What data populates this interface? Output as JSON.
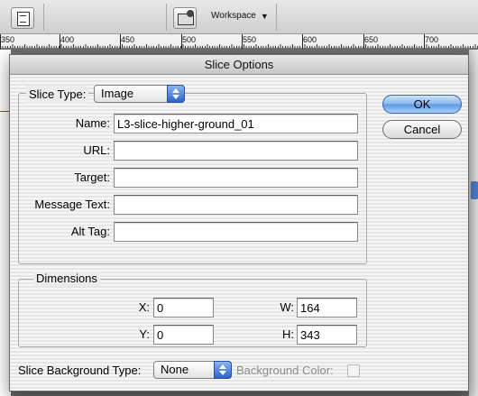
{
  "app": {
    "workspace_label": "Workspace",
    "ruler_labels": [
      "350",
      "400",
      "450",
      "500",
      "550",
      "600",
      "650",
      "700"
    ]
  },
  "dialog": {
    "title": "Slice Options",
    "slice_type": {
      "label": "Slice Type:",
      "value": "Image"
    },
    "fields": {
      "name": {
        "label": "Name:",
        "value": "L3-slice-higher-ground_01"
      },
      "url": {
        "label": "URL:",
        "value": ""
      },
      "target": {
        "label": "Target:",
        "value": ""
      },
      "message_text": {
        "label": "Message Text:",
        "value": ""
      },
      "alt_tag": {
        "label": "Alt Tag:",
        "value": ""
      }
    },
    "dimensions": {
      "legend": "Dimensions",
      "x": {
        "label": "X:",
        "value": "0"
      },
      "y": {
        "label": "Y:",
        "value": "0"
      },
      "w": {
        "label": "W:",
        "value": "164"
      },
      "h": {
        "label": "H:",
        "value": "343"
      }
    },
    "background": {
      "type_label": "Slice Background Type:",
      "type_value": "None",
      "color_label": "Background Color:"
    },
    "buttons": {
      "ok": "OK",
      "cancel": "Cancel"
    }
  }
}
